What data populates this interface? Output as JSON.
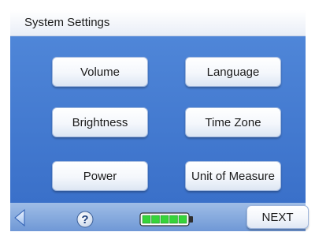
{
  "header": {
    "title": "System Settings"
  },
  "menu": {
    "buttons": [
      {
        "label": "Volume"
      },
      {
        "label": "Language"
      },
      {
        "label": "Brightness"
      },
      {
        "label": "Time Zone"
      },
      {
        "label": "Power"
      },
      {
        "label": "Unit of Measure"
      }
    ]
  },
  "footer": {
    "back_icon": "back-arrow-icon",
    "help_icon": "help-icon",
    "battery": {
      "icon": "battery-icon",
      "charge_level": 1.0
    },
    "next_label": "NEXT"
  },
  "colors": {
    "background": "#ffffff",
    "panel_top": "#4f86d8",
    "panel_bottom": "#3a70c9",
    "footer_top": "#9fbde6",
    "footer_bottom": "#6f98d6",
    "battery_cell": "#35d43a"
  }
}
